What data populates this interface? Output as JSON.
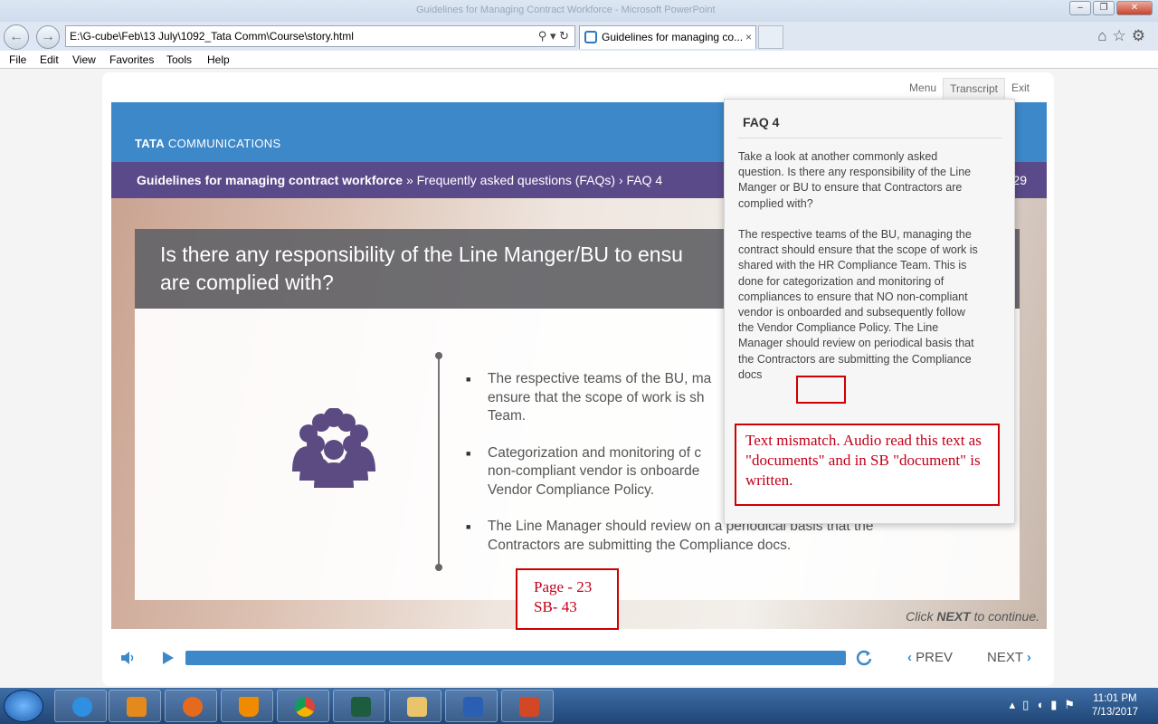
{
  "browser": {
    "window_title": "Guidelines for Managing Contract Workforce - Microsoft PowerPoint",
    "address": "E:\\G-cube\\Feb\\13 July\\1092_Tata Comm\\Course\\story.html",
    "tab_title": "Guidelines for managing co...",
    "tab_close": "×",
    "menu": [
      "File",
      "Edit",
      "View",
      "Favorites",
      "Tools",
      "Help"
    ]
  },
  "player": {
    "top_nav": [
      "Menu",
      "Transcript",
      "Exit"
    ],
    "prev_label": "PREV",
    "next_label": "NEXT",
    "progress_percent": 100
  },
  "slide": {
    "logo_bold": "TATA",
    "logo_rest": "COMMUNICATIONS",
    "breadcrumb_bold": "Guidelines for managing contract workforce",
    "breadcrumb_rest": " » Frequently asked questions (FAQs) › FAQ 4",
    "page_number_fragment": "29",
    "question_line1": "Is there any responsibility of the Line Manger/BU to ensu",
    "question_line2": "are complied with?",
    "bullets": [
      {
        "line1": "The respective teams of the BU, ma",
        "line2": "ensure that the scope of work is sh",
        "line3": "Team."
      },
      {
        "line1": "Categorization and monitoring of c",
        "line2": "non-compliant vendor is onboarde",
        "line3": "Vendor Compliance Policy."
      },
      {
        "line1": "The Line Manager should review on a periodical basis that the",
        "line2": "Contractors are submitting the Compliance docs.",
        "line3": ""
      }
    ],
    "continue_pre": "Click ",
    "continue_bold": "NEXT",
    "continue_post": " to continue."
  },
  "transcript": {
    "title": "FAQ 4",
    "paragraph1": "Take a look at another commonly asked question. Is there any responsibility of the Line Manger or BU to ensure that Contractors are complied with?",
    "paragraph2": "The respective teams of the BU, managing the contract should ensure that the scope of work is shared with the HR Compliance Team. This is done for categorization and monitoring of compliances to ensure that NO non-compliant vendor is onboarded and subsequently follow the Vendor Compliance Policy. The Line Manager should review on periodical basis that the Contractors are submitting the Compliance docs"
  },
  "annotations": {
    "error_note": "Text mismatch. Audio read this text as \"documents\" and in SB \"document\" is written.",
    "page_line1": "Page - 23",
    "page_line2": "SB- 43"
  },
  "taskbar": {
    "time": "11:01 PM",
    "date": "7/13/2017"
  },
  "colors": {
    "header_blue": "#3d88c9",
    "breadcrumb_purple": "#5b4a8a",
    "annotation_red": "#d00000",
    "people_icon": "#5c4b82"
  }
}
